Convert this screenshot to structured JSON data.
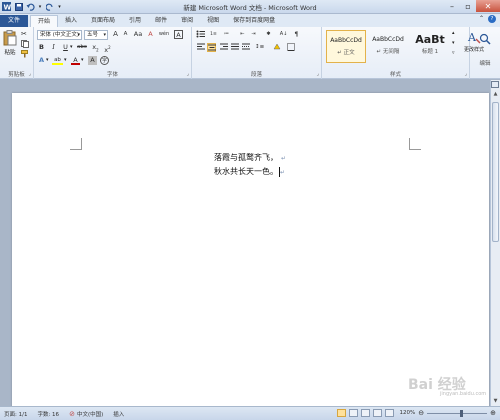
{
  "window": {
    "title": "新建 Microsoft Word 文档 - Microsoft Word"
  },
  "tabs": [
    "文件",
    "开始",
    "插入",
    "页面布局",
    "引用",
    "邮件",
    "审阅",
    "视图",
    "保存到百度网盘"
  ],
  "active_tab": "开始",
  "ribbon": {
    "clipboard": {
      "label": "剪贴板",
      "paste": "粘贴"
    },
    "font": {
      "label": "字体",
      "font_name": "宋体 (中文正文)",
      "font_size": "五号",
      "grow": "A",
      "shrink": "A",
      "aa": "Aa",
      "clear": "A",
      "wen": "wén",
      "char_border": "A",
      "bold": "B",
      "italic": "I",
      "underline": "U",
      "strike": "abc",
      "subscript": "x",
      "superscript": "x",
      "text_effect": "A",
      "highlight": "ab",
      "font_color": "A",
      "char_shade": "A",
      "enclose": "字"
    },
    "paragraph": {
      "label": "段落",
      "sort": "A↓"
    },
    "styles": {
      "label": "样式",
      "items": [
        {
          "sample": "AaBbCcDd",
          "name": "↵ 正文"
        },
        {
          "sample": "AaBbCcDd",
          "name": "↵ 无间隔"
        },
        {
          "sample": "AaBt",
          "name": "标题 1"
        }
      ],
      "change_styles": "更改样式"
    },
    "editing": {
      "label": "编辑"
    }
  },
  "document": {
    "lines": [
      "落霞与孤鹜齐飞，",
      "秋水共长天一色。"
    ]
  },
  "status": {
    "page": "页面: 1/1",
    "words": "字数: 16",
    "lang": "中文(中国)",
    "mode": "插入",
    "zoom": "120%"
  },
  "watermark": {
    "text": "Bai 经验",
    "sub": "jingyan.baidu.com"
  },
  "colors": {
    "file_tab": "#2b5797",
    "highlight_yellow": "#ffe19b",
    "font_red": "#c00000"
  }
}
